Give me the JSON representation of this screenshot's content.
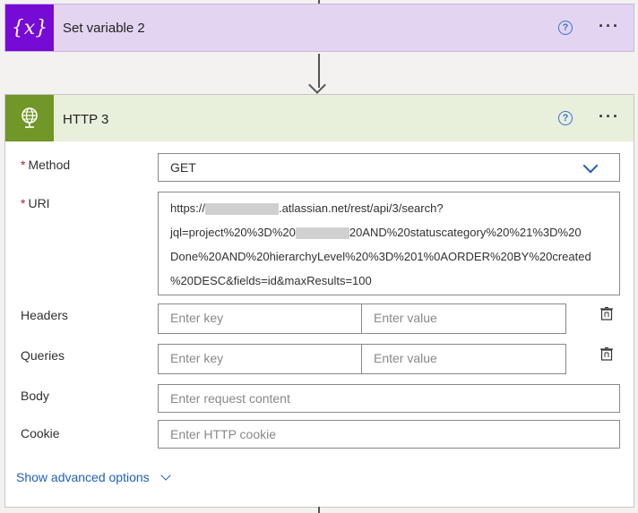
{
  "set_variable_card": {
    "icon_text": "{x}",
    "title": "Set variable 2",
    "help_glyph": "?",
    "more_glyph": "···"
  },
  "http_card": {
    "title": "HTTP 3",
    "icon": "globe-icon",
    "help_glyph": "?",
    "more_glyph": "···",
    "method": {
      "label": "Method",
      "required_mark": "*",
      "value": "GET"
    },
    "uri": {
      "label": "URI",
      "required_mark": "*",
      "lines": [
        {
          "before": "https://",
          "after": ".atlassian.net/rest/api/3/search?"
        },
        {
          "before": "jql=project%20%3D%20",
          "after": "20AND%20statuscategory%20%21%3D%20"
        },
        {
          "before": "Done%20AND%20hierarchyLevel%20%3D%201%0AORDER%20BY%20created",
          "after": ""
        },
        {
          "before": "%20DESC&fields=id&maxResults=100",
          "after": ""
        }
      ]
    },
    "headers": {
      "label": "Headers",
      "key_placeholder": "Enter key",
      "value_placeholder": "Enter value"
    },
    "queries": {
      "label": "Queries",
      "key_placeholder": "Enter key",
      "value_placeholder": "Enter value"
    },
    "body": {
      "label": "Body",
      "placeholder": "Enter request content"
    },
    "cookie": {
      "label": "Cookie",
      "placeholder": "Enter HTTP cookie"
    },
    "advanced_options": "Show advanced options"
  },
  "colors": {
    "set_variable_accent": "#770bd6",
    "set_variable_header": "#e3d5f2",
    "http_accent": "#709727",
    "http_header": "#e8f0dc",
    "link": "#1f5fbf",
    "required": "#a4262c"
  }
}
